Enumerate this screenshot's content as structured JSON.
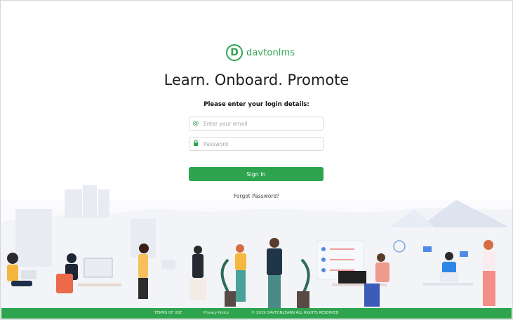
{
  "brand": {
    "logo_letter": "D",
    "name": "davtonlms",
    "color": "#2ea44f"
  },
  "headline": "Learn. Onboard. Promote",
  "subtitle": "Please enter your login details:",
  "form": {
    "email_icon": "@",
    "email_placeholder": "Enter your email",
    "password_placeholder": "Password",
    "signin_label": "Sign In",
    "forgot_label": "Forgot Password?"
  },
  "footer": {
    "terms": "TERMS OF USE",
    "privacy": "Privacy Policy",
    "copyright": "© 2019 DAVTONLEARN ALL RIGHTS RESERVED"
  },
  "icons": {
    "email": "at-icon",
    "password": "lock-icon"
  }
}
